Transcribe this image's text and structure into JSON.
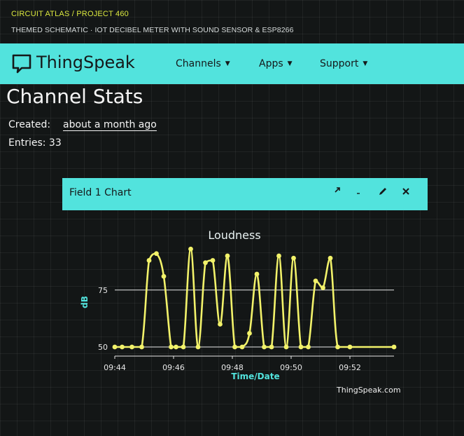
{
  "header": {
    "project_line": "CIRCUIT ATLAS / PROJECT 460",
    "subtitle": "THEMED SCHEMATIC · IOT DECIBEL METER WITH SOUND SENSOR & ESP8266"
  },
  "navbar": {
    "logo_icon": "speech-bubble-logo-icon",
    "brand": "ThingSpeak",
    "items": [
      {
        "label": "Channels",
        "icon": "caret-down-icon"
      },
      {
        "label": "Apps",
        "icon": "caret-down-icon"
      },
      {
        "label": "Support",
        "icon": "caret-down-icon"
      }
    ]
  },
  "stats": {
    "title": "Channel Stats",
    "created_label": "Created:",
    "created_value": "about a month ago",
    "entries_label": "Entries: 33"
  },
  "panel": {
    "title": "Field 1 Chart",
    "tools": [
      "external-link-icon",
      "comment-icon",
      "pencil-icon",
      "close-icon"
    ]
  },
  "colors": {
    "accent": "#52e3dd",
    "series": "#f2f26a",
    "axis_label": "#52e3dd",
    "background": "#131616"
  },
  "chart_data": {
    "type": "line",
    "title": "Loudness",
    "xlabel": "Time/Date",
    "ylabel": "dB",
    "x_ticks": [
      "09:44",
      "09:46",
      "09:48",
      "09:50",
      "09:52"
    ],
    "y_ticks": [
      50,
      75
    ],
    "xlim": [
      "09:44",
      "09:53:30"
    ],
    "ylim": [
      46,
      90
    ],
    "grid": true,
    "series": [
      {
        "x": [
          "09:44:00",
          "09:44:15",
          "09:44:35",
          "09:44:55",
          "09:45:10",
          "09:45:25",
          "09:45:40",
          "09:45:55",
          "09:46:05",
          "09:46:20",
          "09:46:35",
          "09:46:50",
          "09:47:05",
          "09:47:20",
          "09:47:35",
          "09:47:50",
          "09:48:05",
          "09:48:20",
          "09:48:35",
          "09:48:50",
          "09:49:05",
          "09:49:20",
          "09:49:35",
          "09:49:50",
          "09:50:05",
          "09:50:20",
          "09:50:35",
          "09:50:50",
          "09:51:05",
          "09:51:20",
          "09:51:35",
          "09:52:00",
          "09:53:30"
        ],
        "y": [
          50,
          50,
          50,
          50,
          88,
          91,
          81,
          50,
          50,
          50,
          93,
          50,
          87,
          88,
          60,
          90,
          50,
          50,
          56,
          82,
          50,
          50,
          90,
          50,
          89,
          50,
          50,
          79,
          76,
          89,
          50,
          50,
          50
        ]
      }
    ]
  },
  "footer": {
    "watermark": "ThingSpeak.com"
  }
}
